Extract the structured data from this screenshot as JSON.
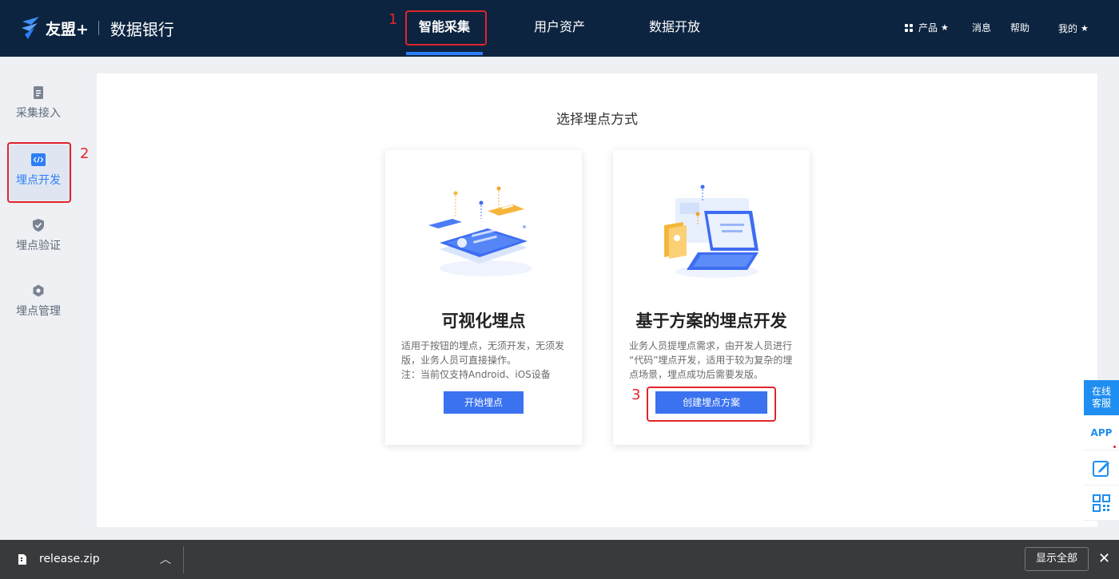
{
  "header": {
    "brand": "友盟+",
    "product": "数据银行",
    "nav": [
      {
        "label": "智能采集",
        "active": true
      },
      {
        "label": "用户资产",
        "active": false
      },
      {
        "label": "数据开放",
        "active": false
      }
    ],
    "right_links": {
      "products": "产品",
      "messages": "消息",
      "help": "帮助",
      "mine": "我的"
    }
  },
  "annotations": {
    "one": "1",
    "two": "2",
    "three": "3",
    "color": "#e0242a"
  },
  "sidebar": {
    "items": [
      {
        "label": "采集接入",
        "icon": "document-icon"
      },
      {
        "label": "埋点开发",
        "icon": "code-icon",
        "active": true
      },
      {
        "label": "埋点验证",
        "icon": "shield-check-icon"
      },
      {
        "label": "埋点管理",
        "icon": "hexagon-icon"
      }
    ]
  },
  "main": {
    "title": "选择埋点方式",
    "cards": [
      {
        "title": "可视化埋点",
        "desc_lines": [
          "适用于按钮的埋点，无须开发，无须发",
          "版，业务人员可直接操作。",
          "注：当前仅支持Android、iOS设备"
        ],
        "button": "开始埋点"
      },
      {
        "title": "基于方案的埋点开发",
        "desc_lines": [
          "业务人员提埋点需求，由开发人员进行",
          "“代码”埋点开发，适用于较为复杂的埋",
          "点场景，埋点成功后需要发版。"
        ],
        "button": "创建埋点方案"
      }
    ]
  },
  "float_tools": {
    "cs_line1": "在线",
    "cs_line2": "客服",
    "app": "APP",
    "icons": [
      "edit-icon",
      "qrcode-icon"
    ]
  },
  "download_bar": {
    "file": "release.zip",
    "show_all": "显示全部"
  },
  "colors": {
    "header_bg": "#0c2440",
    "accent": "#2d7ef7",
    "button": "#3a72f0",
    "float_blue": "#1f8ef0"
  }
}
